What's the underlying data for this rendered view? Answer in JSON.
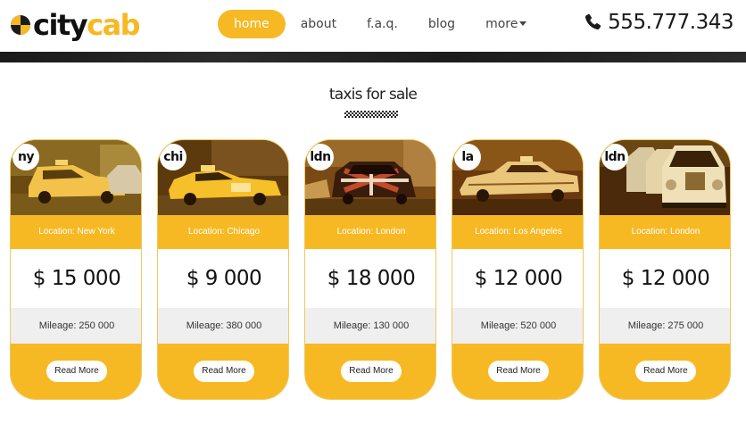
{
  "header": {
    "logo": {
      "city": "city",
      "cab": "cab"
    },
    "nav": [
      {
        "label": "home",
        "active": true
      },
      {
        "label": "about",
        "active": false
      },
      {
        "label": "f.a.q.",
        "active": false
      },
      {
        "label": "blog",
        "active": false
      },
      {
        "label": "more",
        "active": false,
        "dropdown": true
      }
    ],
    "phone": {
      "icon": "phone-icon",
      "number": "555.777.343"
    }
  },
  "section": {
    "title": "taxis for sale"
  },
  "colors": {
    "accent": "#f6b924",
    "dark": "#111111",
    "mileage_bg": "#efefef"
  },
  "cards": [
    {
      "badge": "ny",
      "location": "Location: New York",
      "price": "$ 15 000",
      "mileage": "Mileage: 250 000",
      "button": "Read More"
    },
    {
      "badge": "chi",
      "location": "Location: Chicago",
      "price": "$ 9 000",
      "mileage": "Mileage: 380 000",
      "button": "Read More"
    },
    {
      "badge": "ldn",
      "location": "Location: London",
      "price": "$ 18 000",
      "mileage": "Mileage: 130 000",
      "button": "Read More"
    },
    {
      "badge": "la",
      "location": "Location: Los Angeles",
      "price": "$ 12 000",
      "mileage": "Mileage: 520 000",
      "button": "Read More"
    },
    {
      "badge": "ldn",
      "location": "Location: London",
      "price": "$ 12 000",
      "mileage": "Mileage: 275 000",
      "button": "Read More"
    }
  ]
}
